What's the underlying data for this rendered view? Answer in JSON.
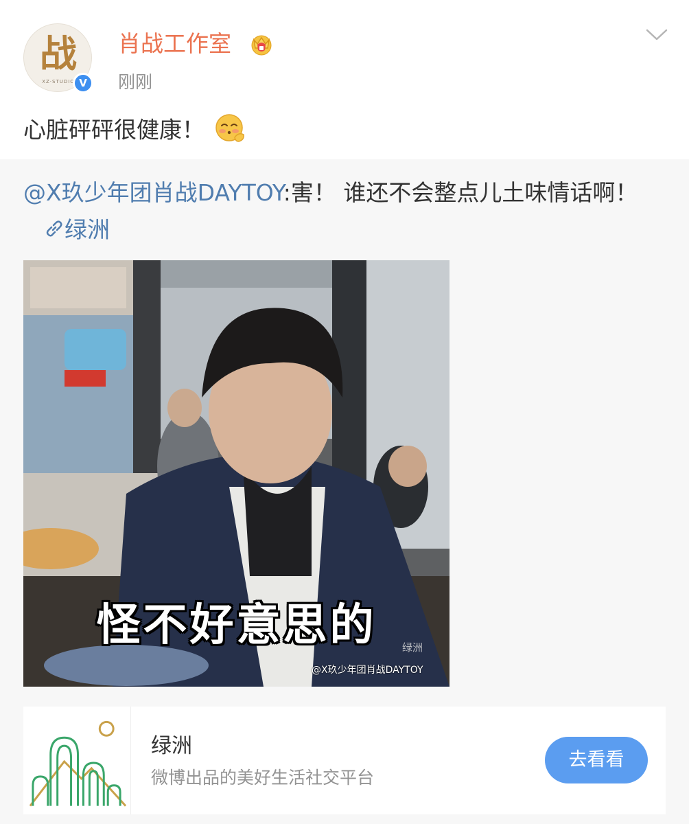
{
  "post": {
    "user_name": "肖战工作室",
    "time": "刚刚",
    "text": "心脏砰砰很健康！",
    "avatar_text": "战",
    "avatar_subtext": "XZ·STUDIO",
    "verified_mark": "V"
  },
  "retweet": {
    "mention": "@X玖少年团肖战DAYTOY",
    "text": ":害！ 谁还不会整点儿土味情话啊！",
    "link_label": "绿洲",
    "media": {
      "caption": "怪不好意思的",
      "watermark": "@X玖少年团肖战DAYTOY",
      "watermark_2": "绿洲"
    }
  },
  "card": {
    "title": "绿洲",
    "description": "微博出品的美好生活社交平台",
    "button_label": "去看看"
  },
  "colors": {
    "username": "#eb7350",
    "link": "#507daf",
    "button": "#5b9df0",
    "verified": "#3d8ff0"
  }
}
